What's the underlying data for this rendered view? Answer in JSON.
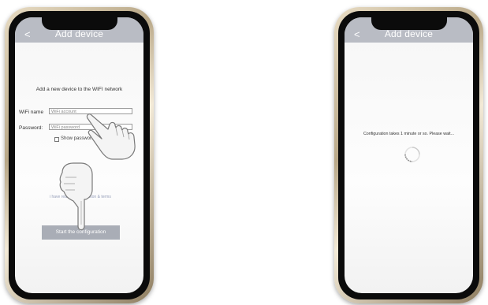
{
  "left_screen": {
    "header": {
      "back_label": "<",
      "title": "Add device"
    },
    "heading": "Add a new device to the WIFI network",
    "wifi_label": "WiFi name",
    "wifi_value": "WiFi account",
    "password_label": "Password:",
    "password_value": "WiFi password",
    "show_password_label": "Show password",
    "link_text": "i have read the information & terms",
    "start_button_label": "Start the configuration"
  },
  "right_screen": {
    "header": {
      "back_label": "<",
      "title": "Add device"
    },
    "message": "Configuration takes 1 minute or so. Please wait..."
  },
  "colors": {
    "appbar": "#b9bcc4",
    "button": "#a9adb6",
    "phone_frame": "#b9a888"
  },
  "icons": [
    "back-chevron-icon",
    "pointing-hand-icon",
    "loading-spinner-icon"
  ]
}
